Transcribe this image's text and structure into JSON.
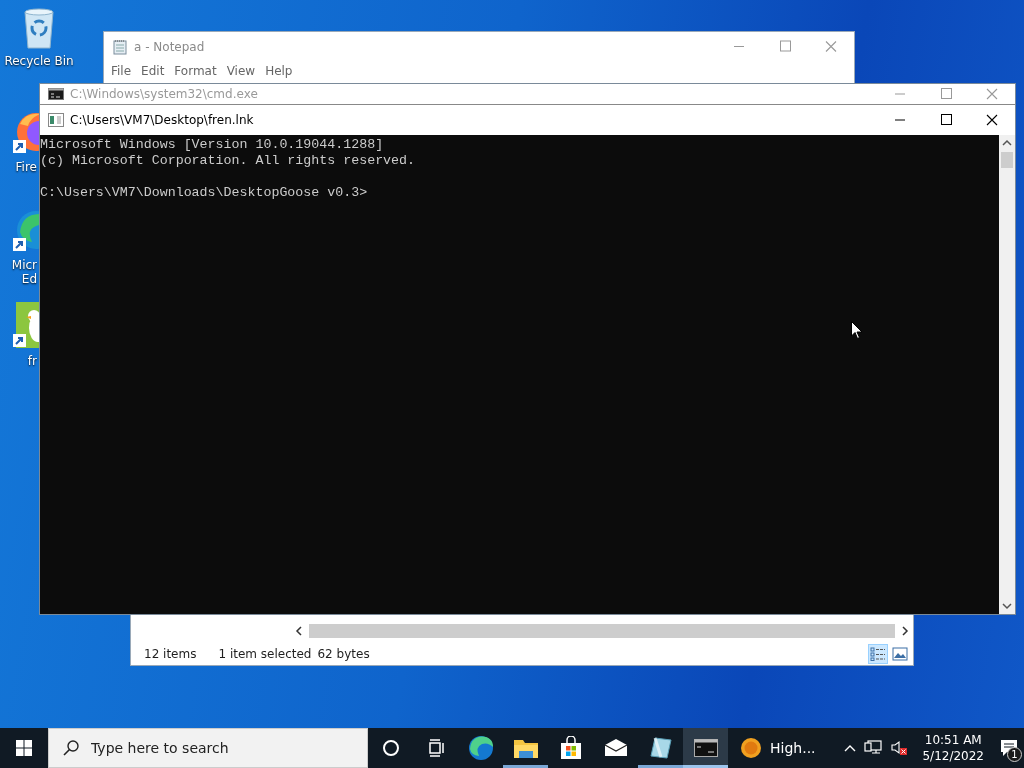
{
  "desktop_icons": [
    {
      "kind": "recycle-bin",
      "lines": [
        "Recycle Bin"
      ]
    },
    {
      "kind": "firefox",
      "lines": [
        "Fire"
      ]
    },
    {
      "kind": "edge",
      "lines": [
        "Micr",
        "Ed"
      ]
    },
    {
      "kind": "goose",
      "lines": [
        "fr"
      ]
    }
  ],
  "notepad": {
    "title": "a - Notepad",
    "active": false,
    "menu": [
      "File",
      "Edit",
      "Format",
      "View",
      "Help"
    ]
  },
  "explorer": {
    "status": [
      "12 items",
      "1 item selected",
      "62 bytes"
    ],
    "views": [
      {
        "kind": "details",
        "selected": true
      },
      {
        "kind": "large-icons",
        "selected": false
      }
    ]
  },
  "cmd_window": {
    "title": "C:\\Windows\\system32\\cmd.exe",
    "active": false
  },
  "console_window": {
    "title": "C:\\Users\\VM7\\Desktop\\fren.lnk",
    "active": true,
    "lines": [
      "Microsoft Windows [Version 10.0.19044.1288]",
      "(c) Microsoft Corporation. All rights reserved."
    ],
    "prompt": "C:\\Users\\VM7\\Downloads\\DesktopGoose v0.3>"
  },
  "taskbar": {
    "search": {
      "placeholder": "Type here to search"
    },
    "apps": [
      {
        "kind": "cortana",
        "running": false,
        "selected": false
      },
      {
        "kind": "task-view",
        "running": false,
        "selected": false
      },
      {
        "kind": "edge",
        "running": false,
        "selected": false
      },
      {
        "kind": "file-explorer",
        "running": true,
        "selected": false
      },
      {
        "kind": "store",
        "running": false,
        "selected": false
      },
      {
        "kind": "mail",
        "running": false,
        "selected": false
      },
      {
        "kind": "notepad",
        "running": true,
        "selected": false
      },
      {
        "kind": "terminal",
        "running": true,
        "selected": true
      },
      {
        "kind": "uv-app",
        "label": "High...",
        "running": false,
        "selected": false
      }
    ],
    "clock": {
      "time": "10:51 AM",
      "date": "5/12/2022"
    },
    "notifications": {
      "count": "1"
    }
  }
}
